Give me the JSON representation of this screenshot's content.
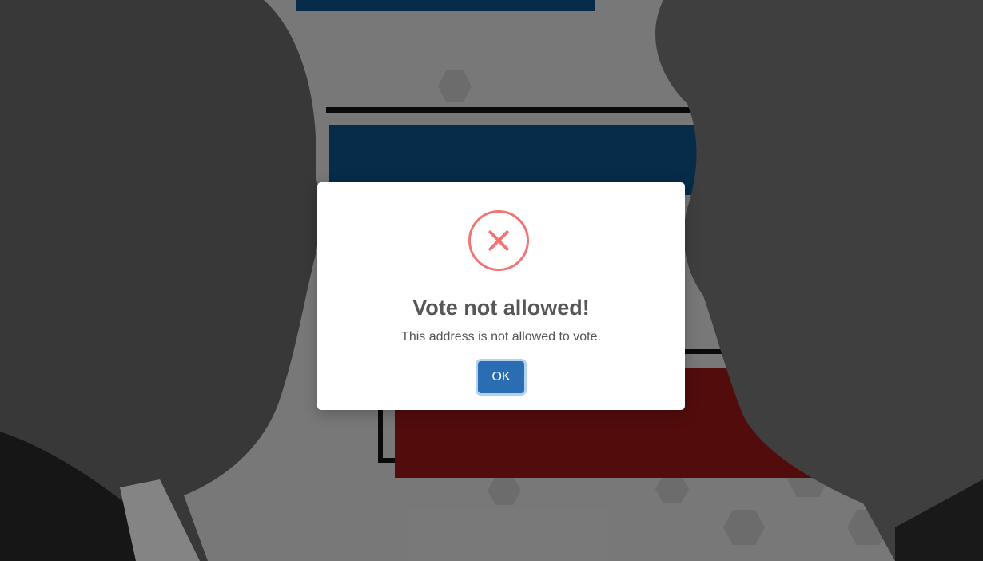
{
  "dialog": {
    "title": "Vote not allowed!",
    "message": "This address is not allowed to vote.",
    "confirm_label": "OK",
    "icon": "error-x-icon"
  },
  "colors": {
    "error": "#f27474",
    "confirm_button": "#2a6db3",
    "blue_bar": "#0a4a7a",
    "red_bar": "#8a1414"
  }
}
